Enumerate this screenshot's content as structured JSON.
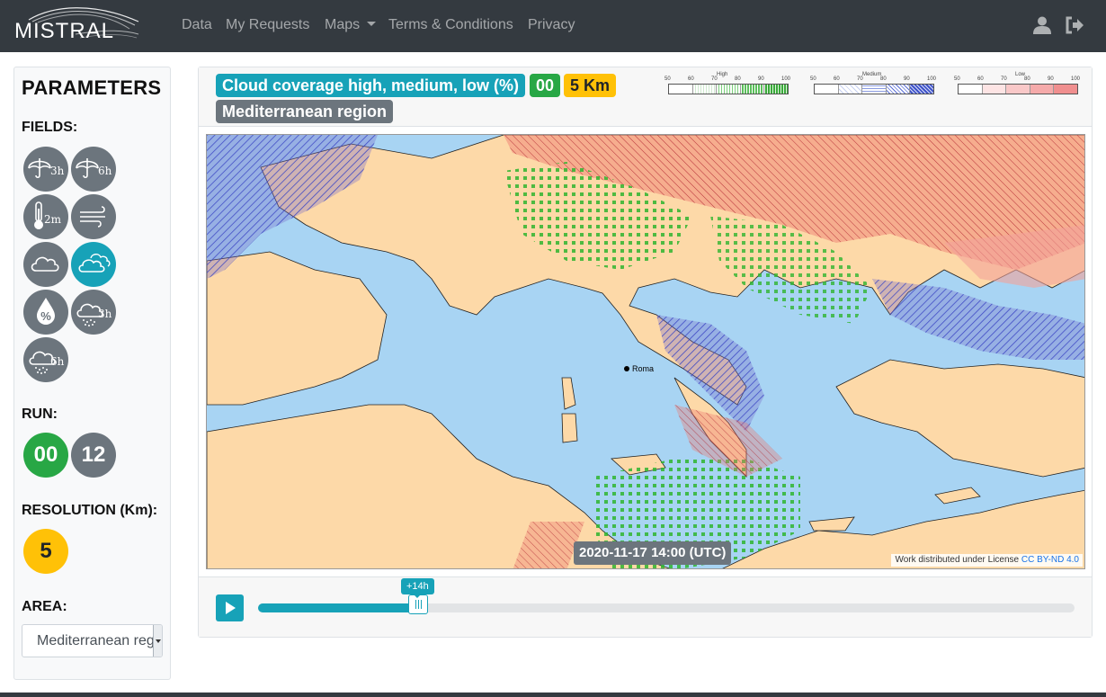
{
  "navbar": {
    "brand": "MISTRAL",
    "links": [
      "Data",
      "My Requests",
      "Maps",
      "Terms & Conditions",
      "Privacy"
    ],
    "user_icon": "user-icon",
    "logout_icon": "sign-out-icon",
    "bg_color": "#343a40"
  },
  "sidebar": {
    "title": "PARAMETERS",
    "fields_label": "FIELDS:",
    "fields": [
      {
        "icon": "umbrella-icon",
        "sub": "3h",
        "active": false
      },
      {
        "icon": "umbrella-icon",
        "sub": "6h",
        "active": false
      },
      {
        "icon": "thermometer-icon",
        "sub": "2m",
        "active": false
      },
      {
        "icon": "wind-icon",
        "sub": "",
        "active": false
      },
      {
        "icon": "cloud-icon",
        "sub": "",
        "active": false
      },
      {
        "icon": "cloud-layers-icon",
        "sub": "",
        "active": true
      },
      {
        "icon": "humidity-icon",
        "sub": "",
        "active": false
      },
      {
        "icon": "snow-cloud-icon",
        "sub": "3h",
        "active": false
      },
      {
        "icon": "snow-cloud-icon",
        "sub": "6h",
        "active": false
      }
    ],
    "run_label": "RUN:",
    "runs": [
      {
        "label": "00",
        "active": true,
        "color": "#28a745"
      },
      {
        "label": "12",
        "active": false,
        "color": "#6c757d"
      }
    ],
    "resolution_label": "RESOLUTION (Km):",
    "resolution": {
      "label": "5",
      "color": "#ffc107"
    },
    "area_label": "AREA:",
    "area_value": "Mediterranean region"
  },
  "map_card": {
    "badges": {
      "field": "Cloud coverage high, medium, low (%)",
      "run": "00",
      "resolution": "5 Km",
      "area": "Mediterranean region"
    },
    "legend": [
      {
        "title": "High",
        "ticks": [
          "50",
          "60",
          "70",
          "80",
          "90",
          "100"
        ]
      },
      {
        "title": "Medium",
        "ticks": [
          "50",
          "60",
          "70",
          "80",
          "90",
          "100"
        ]
      },
      {
        "title": "Low",
        "ticks": [
          "50",
          "60",
          "70",
          "80",
          "90",
          "100"
        ]
      }
    ],
    "city_label": "Roma",
    "timestamp": "2020-11-17 14:00 (UTC)",
    "license_text": "Work distributed under License",
    "license_link": "CC BY-ND 4.0"
  },
  "player": {
    "step_label": "+14h",
    "progress": 0.196,
    "accent": "#17a2b8"
  }
}
